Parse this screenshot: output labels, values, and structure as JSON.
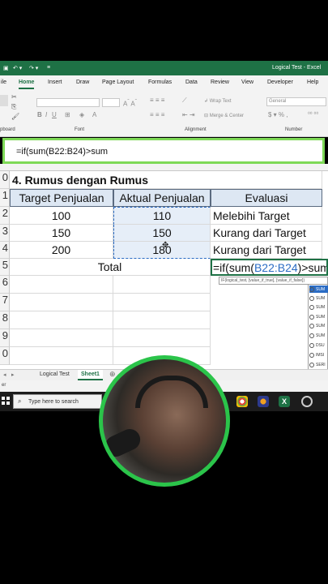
{
  "window": {
    "title": "Logical Test - Excel"
  },
  "ribbon": {
    "tabs": [
      "ile",
      "Home",
      "Insert",
      "Draw",
      "Page Layout",
      "Formulas",
      "Data",
      "Review",
      "View",
      "Developer",
      "Help"
    ],
    "active_tab": "Home",
    "wrap_text": "Wrap Text",
    "merge_center": "Merge & Center",
    "number_format": "General",
    "groups": {
      "clipboard": "pboard",
      "font": "Font",
      "alignment": "Alignment",
      "number": "Number"
    }
  },
  "formula_bar": {
    "value": "=if(sum(B22:B24)>sum"
  },
  "grid": {
    "row_numbers": [
      "0",
      "1",
      "2",
      "3",
      "4",
      "5",
      "6",
      "7",
      "8",
      "9",
      "0"
    ],
    "section_title": "4. Rumus dengan Rumus",
    "headers": [
      "Target Penjualan",
      "Aktual Penjualan",
      "Evaluasi"
    ],
    "rows": [
      {
        "target": "100",
        "aktual": "110",
        "evaluasi": "Melebihi Target"
      },
      {
        "target": "150",
        "aktual": "150",
        "evaluasi": "Kurang dari Target"
      },
      {
        "target": "200",
        "aktual": "180",
        "evaluasi": "Kurang dari Target"
      }
    ],
    "total_label": "Total",
    "editing_cell": "=if(sum(B22:B24)>sum",
    "editing_cell_prefix": "=if(sum(",
    "editing_cell_ref": "B22:B24",
    "editing_cell_suffix": ")>sum"
  },
  "tooltip": "IF(logical_test, [value_if_true], [value_if_false])",
  "autocomplete": [
    "SUM",
    "SUM",
    "SUM",
    "SUM",
    "SUM",
    "SUM",
    "DSU",
    "IMSI",
    "SERI"
  ],
  "sheets": {
    "tabs": [
      "Logical Test",
      "Sheet1"
    ],
    "active": "Sheet1"
  },
  "statusbar": {
    "text": "er"
  },
  "taskbar": {
    "search_placeholder": "Type here to search"
  },
  "colors": {
    "excel_green": "#1e7145",
    "highlight_border": "#7ed957",
    "header_fill": "#dde7f3",
    "ref_blue": "#2b6cc4"
  }
}
